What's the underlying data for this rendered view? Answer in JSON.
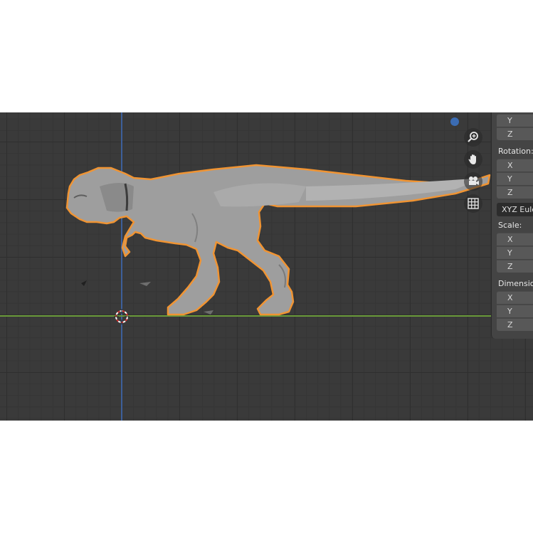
{
  "panel": {
    "location_axes": [
      "Y",
      "Z"
    ],
    "rotation_label": "Rotation:",
    "rotation_axes": [
      "X",
      "Y",
      "Z"
    ],
    "rotation_mode": "XYZ Eule",
    "scale_label": "Scale:",
    "scale_axes": [
      "X",
      "Y",
      "Z"
    ],
    "dimensions_label": "Dimension",
    "dimensions_axes": [
      "X",
      "Y",
      "Z"
    ]
  },
  "nav_icons": [
    "zoom-icon",
    "pan-hand-icon",
    "camera-icon",
    "grid-icon"
  ],
  "colors": {
    "viewport_bg": "#3a3a3a",
    "selection_outline": "#f09433",
    "z_axis": "#3d5f9a",
    "y_axis": "#6a9a3a",
    "model": "#9e9e9e"
  }
}
